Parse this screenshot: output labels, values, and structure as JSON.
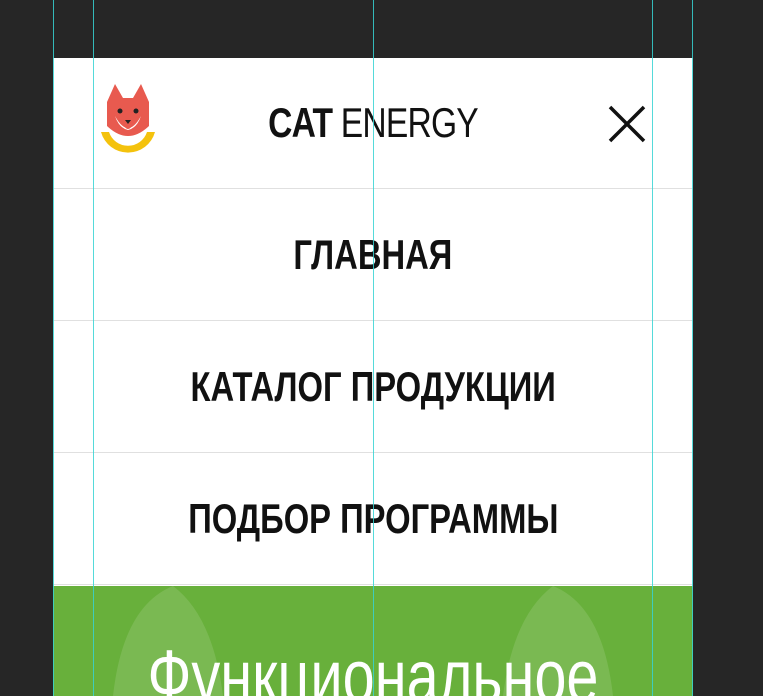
{
  "header": {
    "brand_bold": "CAT",
    "brand_light": "ENERGY",
    "logo_icon": "cat-logo-icon",
    "close_icon": "close-icon"
  },
  "menu": {
    "items": [
      {
        "label": "ГЛАВНАЯ"
      },
      {
        "label": "КАТАЛОГ ПРОДУКЦИИ"
      },
      {
        "label": "ПОДБОР ПРОГРАММЫ"
      }
    ]
  },
  "hero": {
    "title": "Функциональное"
  },
  "colors": {
    "background": "#262626",
    "accent": "#68b03b",
    "guide": "#37d4d4",
    "text": "#111111"
  }
}
